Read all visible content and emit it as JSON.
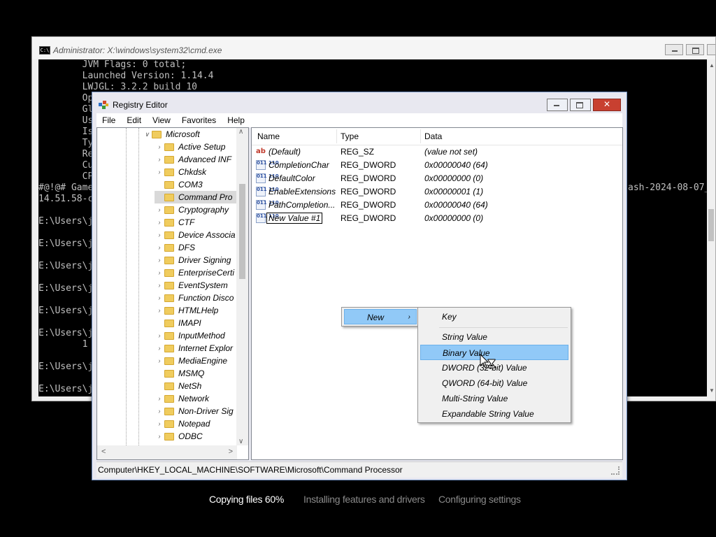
{
  "cmd": {
    "title": "Administrator: X:\\windows\\system32\\cmd.exe",
    "icon_label": "C:\\",
    "lines": [
      "        JVM Flags: 0 total;",
      "        Launched Version: 1.14.4",
      "        LWJGL: 3.2.2 build 10",
      "        Op",
      "        Gl",
      "        Us",
      "        Is",
      "        Ty",
      "        Re",
      "        Cu",
      "        CP",
      "#@!@# Game",
      "14.51.58-c",
      "",
      "E:\\Users\\j",
      "",
      "E:\\Users\\j",
      "",
      "E:\\Users\\j",
      "",
      "E:\\Users\\j",
      "",
      "E:\\Users\\j",
      "",
      "E:\\Users\\j",
      "        1",
      "",
      "E:\\Users\\j",
      "",
      "E:\\Users\\j"
    ],
    "right_fragment": "ash-2024-08-07_"
  },
  "regedit": {
    "title": "Registry Editor",
    "menu": [
      "File",
      "Edit",
      "View",
      "Favorites",
      "Help"
    ],
    "tree": {
      "root": "Microsoft",
      "items": [
        {
          "label": "Active Setup",
          "expandable": true
        },
        {
          "label": "Advanced INF",
          "expandable": true
        },
        {
          "label": "Chkdsk",
          "expandable": true
        },
        {
          "label": "COM3",
          "expandable": false
        },
        {
          "label": "Command Pro",
          "expandable": false,
          "selected": true
        },
        {
          "label": "Cryptography",
          "expandable": true
        },
        {
          "label": "CTF",
          "expandable": true
        },
        {
          "label": "Device Associa",
          "expandable": true
        },
        {
          "label": "DFS",
          "expandable": true
        },
        {
          "label": "Driver Signing",
          "expandable": true
        },
        {
          "label": "EnterpriseCerti",
          "expandable": true
        },
        {
          "label": "EventSystem",
          "expandable": true
        },
        {
          "label": "Function Disco",
          "expandable": true
        },
        {
          "label": "HTMLHelp",
          "expandable": true
        },
        {
          "label": "IMAPI",
          "expandable": false
        },
        {
          "label": "InputMethod",
          "expandable": true
        },
        {
          "label": "Internet Explor",
          "expandable": true
        },
        {
          "label": "MediaEngine",
          "expandable": true
        },
        {
          "label": "MSMQ",
          "expandable": false
        },
        {
          "label": "NetSh",
          "expandable": false
        },
        {
          "label": "Network",
          "expandable": true
        },
        {
          "label": "Non-Driver Sig",
          "expandable": true
        },
        {
          "label": "Notepad",
          "expandable": true
        },
        {
          "label": "ODBC",
          "expandable": true
        }
      ]
    },
    "columns": {
      "name": "Name",
      "type": "Type",
      "data": "Data"
    },
    "values": [
      {
        "name": "(Default)",
        "type": "REG_SZ",
        "data": "(value not set)",
        "icon": "string-value-icon"
      },
      {
        "name": "CompletionChar",
        "type": "REG_DWORD",
        "data": "0x00000040 (64)",
        "icon": "dword-value-icon"
      },
      {
        "name": "DefaultColor",
        "type": "REG_DWORD",
        "data": "0x00000000 (0)",
        "icon": "dword-value-icon"
      },
      {
        "name": "EnableExtensions",
        "type": "REG_DWORD",
        "data": "0x00000001 (1)",
        "icon": "dword-value-icon"
      },
      {
        "name": "PathCompletion...",
        "type": "REG_DWORD",
        "data": "0x00000040 (64)",
        "icon": "dword-value-icon"
      },
      {
        "name": "New Value #1",
        "type": "REG_DWORD",
        "data": "0x00000000 (0)",
        "icon": "dword-value-icon",
        "editing": true
      }
    ],
    "status_path": "Computer\\HKEY_LOCAL_MACHINE\\SOFTWARE\\Microsoft\\Command Processor",
    "icon_glyphs": {
      "string": "ab",
      "dword": "011 110"
    }
  },
  "context_menu": {
    "parent": "New",
    "submenu": [
      "Key",
      "String Value",
      "Binary Value",
      "DWORD (32-bit) Value",
      "QWORD (64-bit) Value",
      "Multi-String Value",
      "Expandable String Value"
    ],
    "highlighted": "Binary Value"
  },
  "setup_status": [
    "Copying files 60%",
    "Installing features and drivers",
    "Configuring settings"
  ],
  "colors": {
    "highlight": "#91c9f7",
    "folder": "#f0cc5e",
    "close_button": "#c84030",
    "setup_active": "#ffffff",
    "setup_inactive": "#8a8a8a"
  }
}
